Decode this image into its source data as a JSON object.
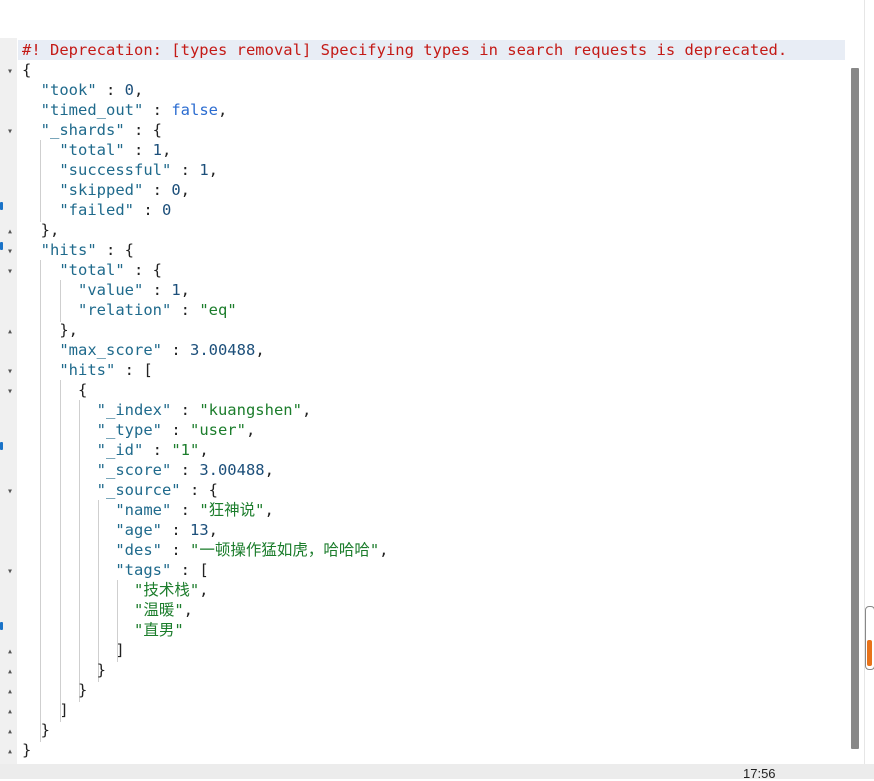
{
  "console": {
    "deprecation": "#! Deprecation: [types removal] Specifying types in search requests is deprecated."
  },
  "response": {
    "l1": "{",
    "took_key": "\"took\"",
    "took_val": "0",
    "timed_out_key": "\"timed_out\"",
    "timed_out_val": "false",
    "shards_key": "\"_shards\"",
    "total_key": "\"total\"",
    "total_val": "1",
    "successful_key": "\"successful\"",
    "successful_val": "1",
    "skipped_key": "\"skipped\"",
    "skipped_val": "0",
    "failed_key": "\"failed\"",
    "failed_val": "0",
    "shards_close": "},",
    "hits_key": "\"hits\"",
    "hits_total_key": "\"total\"",
    "value_key": "\"value\"",
    "value_val": "1",
    "relation_key": "\"relation\"",
    "relation_val": "\"eq\"",
    "hits_total_close": "},",
    "max_score_key": "\"max_score\"",
    "max_score_val": "3.00488",
    "hits_arr_key": "\"hits\"",
    "doc_open": "{",
    "index_key": "\"_index\"",
    "index_val": "\"kuangshen\"",
    "type_key": "\"_type\"",
    "type_val": "\"user\"",
    "id_key": "\"_id\"",
    "id_val": "\"1\"",
    "score_key": "\"_score\"",
    "score_val": "3.00488",
    "source_key": "\"_source\"",
    "name_key": "\"name\"",
    "name_val": "\"狂神说\"",
    "age_key": "\"age\"",
    "age_val": "13",
    "des_key": "\"des\"",
    "des_val": "\"一顿操作猛如虎，哈哈哈\"",
    "tags_key": "\"tags\"",
    "tag1": "\"技术栈\"",
    "tag2": "\"温暖\"",
    "tag3": "\"直男\"",
    "tags_close": "]",
    "source_close": "}",
    "doc_close": "}",
    "hits_arr_close": "]",
    "hits_close": "}",
    "root_close": "}"
  },
  "taskbar": {
    "time": "17:56"
  },
  "colors": {
    "deprecation": "#c41a16",
    "key": "#1f6a8c",
    "string": "#1c7d2c",
    "number": "#1c4f7a",
    "boolean": "#2b6cd0"
  }
}
